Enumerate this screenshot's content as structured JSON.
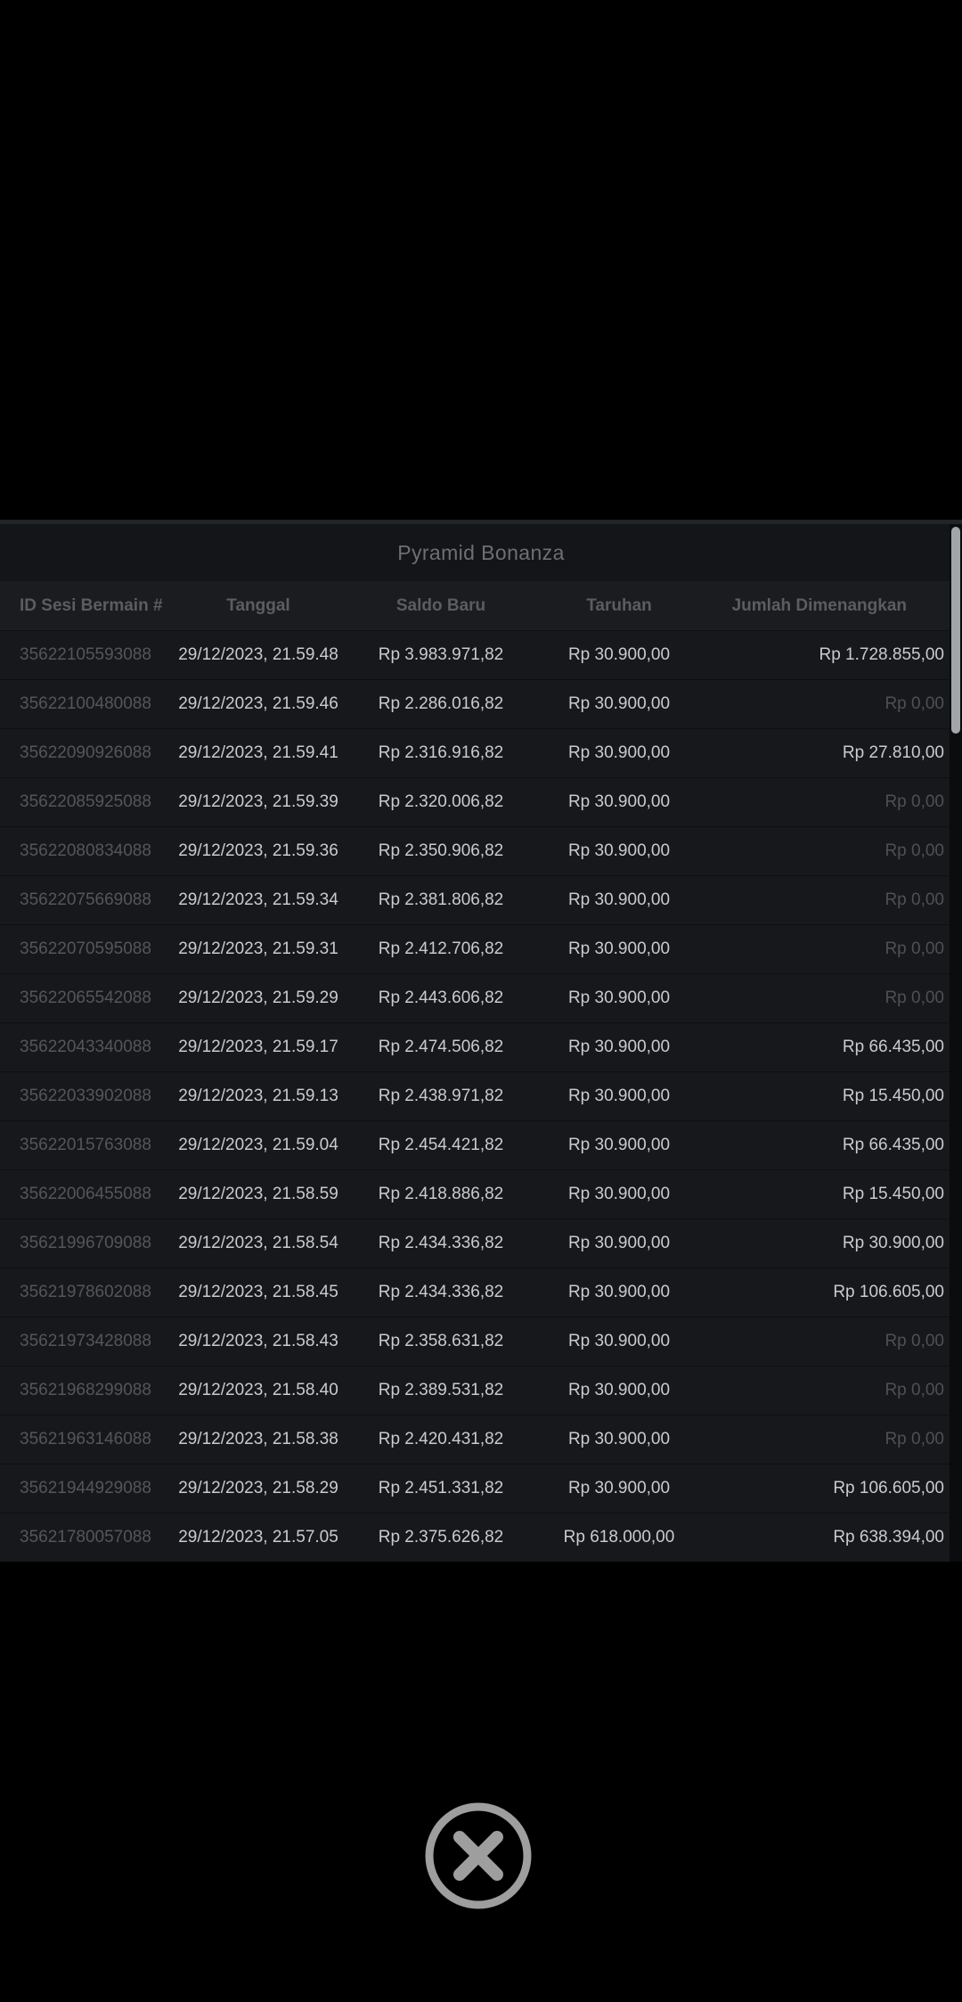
{
  "modal": {
    "title": "Pyramid Bonanza"
  },
  "table": {
    "columns": [
      "ID Sesi Bermain #",
      "Tanggal",
      "Saldo Baru",
      "Taruhan",
      "Jumlah Dimenangkan"
    ],
    "zero_win_value": "Rp 0,00",
    "rows": [
      {
        "id": "35622105593088",
        "date": "29/12/2023, 21.59.48",
        "balance": "Rp 3.983.971,82",
        "bet": "Rp 30.900,00",
        "win": "Rp 1.728.855,00"
      },
      {
        "id": "35622100480088",
        "date": "29/12/2023, 21.59.46",
        "balance": "Rp 2.286.016,82",
        "bet": "Rp 30.900,00",
        "win": "Rp 0,00"
      },
      {
        "id": "35622090926088",
        "date": "29/12/2023, 21.59.41",
        "balance": "Rp 2.316.916,82",
        "bet": "Rp 30.900,00",
        "win": "Rp 27.810,00"
      },
      {
        "id": "35622085925088",
        "date": "29/12/2023, 21.59.39",
        "balance": "Rp 2.320.006,82",
        "bet": "Rp 30.900,00",
        "win": "Rp 0,00"
      },
      {
        "id": "35622080834088",
        "date": "29/12/2023, 21.59.36",
        "balance": "Rp 2.350.906,82",
        "bet": "Rp 30.900,00",
        "win": "Rp 0,00"
      },
      {
        "id": "35622075669088",
        "date": "29/12/2023, 21.59.34",
        "balance": "Rp 2.381.806,82",
        "bet": "Rp 30.900,00",
        "win": "Rp 0,00"
      },
      {
        "id": "35622070595088",
        "date": "29/12/2023, 21.59.31",
        "balance": "Rp 2.412.706,82",
        "bet": "Rp 30.900,00",
        "win": "Rp 0,00"
      },
      {
        "id": "35622065542088",
        "date": "29/12/2023, 21.59.29",
        "balance": "Rp 2.443.606,82",
        "bet": "Rp 30.900,00",
        "win": "Rp 0,00"
      },
      {
        "id": "35622043340088",
        "date": "29/12/2023, 21.59.17",
        "balance": "Rp 2.474.506,82",
        "bet": "Rp 30.900,00",
        "win": "Rp 66.435,00"
      },
      {
        "id": "35622033902088",
        "date": "29/12/2023, 21.59.13",
        "balance": "Rp 2.438.971,82",
        "bet": "Rp 30.900,00",
        "win": "Rp 15.450,00"
      },
      {
        "id": "35622015763088",
        "date": "29/12/2023, 21.59.04",
        "balance": "Rp 2.454.421,82",
        "bet": "Rp 30.900,00",
        "win": "Rp 66.435,00"
      },
      {
        "id": "35622006455088",
        "date": "29/12/2023, 21.58.59",
        "balance": "Rp 2.418.886,82",
        "bet": "Rp 30.900,00",
        "win": "Rp 15.450,00"
      },
      {
        "id": "35621996709088",
        "date": "29/12/2023, 21.58.54",
        "balance": "Rp 2.434.336,82",
        "bet": "Rp 30.900,00",
        "win": "Rp 30.900,00"
      },
      {
        "id": "35621978602088",
        "date": "29/12/2023, 21.58.45",
        "balance": "Rp 2.434.336,82",
        "bet": "Rp 30.900,00",
        "win": "Rp 106.605,00"
      },
      {
        "id": "35621973428088",
        "date": "29/12/2023, 21.58.43",
        "balance": "Rp 2.358.631,82",
        "bet": "Rp 30.900,00",
        "win": "Rp 0,00"
      },
      {
        "id": "35621968299088",
        "date": "29/12/2023, 21.58.40",
        "balance": "Rp 2.389.531,82",
        "bet": "Rp 30.900,00",
        "win": "Rp 0,00"
      },
      {
        "id": "35621963146088",
        "date": "29/12/2023, 21.58.38",
        "balance": "Rp 2.420.431,82",
        "bet": "Rp 30.900,00",
        "win": "Rp 0,00"
      },
      {
        "id": "35621944929088",
        "date": "29/12/2023, 21.58.29",
        "balance": "Rp 2.451.331,82",
        "bet": "Rp 30.900,00",
        "win": "Rp 106.605,00"
      },
      {
        "id": "35621780057088",
        "date": "29/12/2023, 21.57.05",
        "balance": "Rp 2.375.626,82",
        "bet": "Rp 618.000,00",
        "win": "Rp 638.394,00"
      }
    ]
  },
  "colors": {
    "win_text": "#c9cbcd",
    "zero_win_text": "#4d5054",
    "scrollbar_thumb": "#a3a6a8",
    "close_icon": "#9e9e9e"
  },
  "close": {
    "icon": "circle-x-icon"
  }
}
